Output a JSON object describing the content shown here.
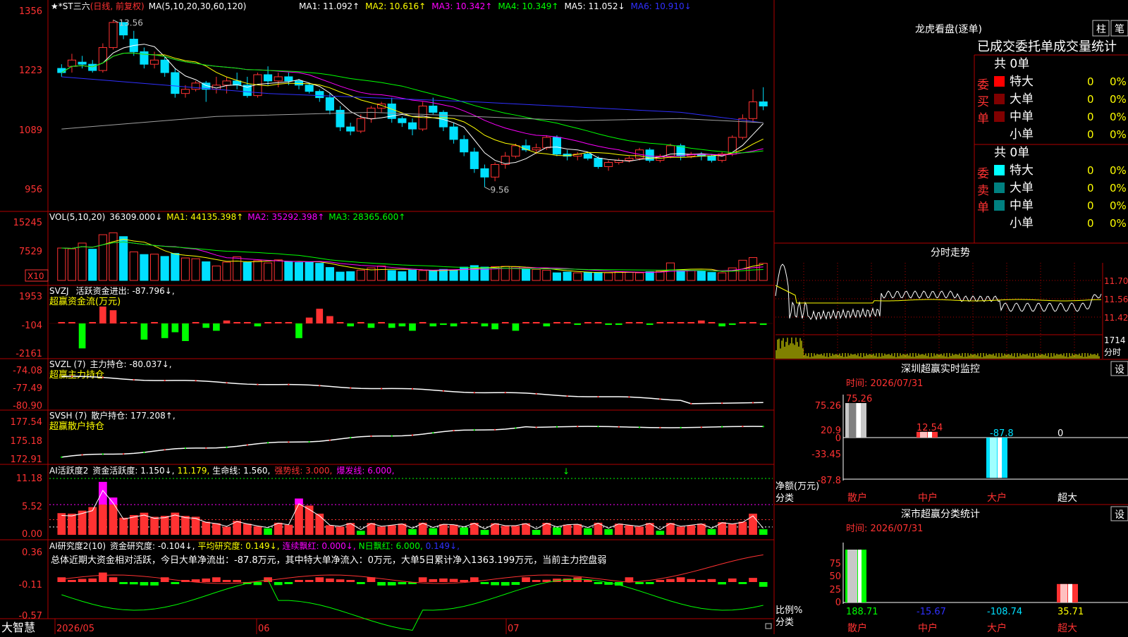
{
  "colors": {
    "up": "#ff3232",
    "down": "#00e0ff",
    "grid": "#b00000",
    "yellow": "#ffff00",
    "white": "#ffffff",
    "magenta": "#ff00ff",
    "green": "#00ff00",
    "blue": "#3030ff",
    "gray": "#a0a0a0"
  },
  "main": {
    "title_prefix": "★*ST三六",
    "title_mode": "(日线, 前复权)",
    "ma_label": "MA(5,10,20,30,60,120)",
    "ma_values": [
      {
        "text": "MA1: 11.092↑",
        "color": "#ffffff"
      },
      {
        "text": "MA2: 10.616↑",
        "color": "#ffff00"
      },
      {
        "text": "MA3: 10.342↑",
        "color": "#ff00ff"
      },
      {
        "text": "MA4: 10.349↑",
        "color": "#00ff00"
      },
      {
        "text": "MA5: 11.052↓",
        "color": "#ffffff"
      },
      {
        "text": "MA6: 10.910↓",
        "color": "#3030ff"
      }
    ],
    "y_ticks": [
      "1356",
      "1223",
      "1089",
      "956"
    ],
    "high_label": "13.56",
    "low_label": "9.56"
  },
  "vol": {
    "title": "VOL(5,10,20)",
    "value": "36309.000↓",
    "ma1": "MA1: 44135.398↑",
    "ma2": "MA2: 35292.398↑",
    "ma3": "MA3: 28365.600↑",
    "y_ticks": [
      "15245",
      "7529"
    ],
    "unit": "X10"
  },
  "svzj": {
    "title": "SVZJ",
    "label": "活跃资金进出: -87.796↓,",
    "sub": "超赢资金流(万元)",
    "y_ticks": [
      "1953",
      "-104",
      "-2161"
    ]
  },
  "svzl": {
    "title": "SVZL (7)",
    "label": "主力持仓: -80.037↓,",
    "sub": "超赢主力持仓",
    "y_ticks": [
      "-74.08",
      "-77.49",
      "-80.90"
    ]
  },
  "svsh": {
    "title": "SVSH (7)",
    "label": "散户持仓: 177.208↑,",
    "sub": "超赢散户持仓",
    "y_ticks": [
      "177.54",
      "175.18",
      "172.91"
    ]
  },
  "ai1": {
    "title": "AI活跃度2",
    "label": "资金活跃度: 1.150↓,",
    "v2": "11.179,",
    "v3": "生命线: 1.560,",
    "v4": "强势线: 3.000,",
    "v5": "爆发线: 6.000,",
    "y_ticks": [
      "11.18",
      "5.52",
      "0.00"
    ]
  },
  "ai2": {
    "title": "AI研究度2(10)",
    "label": "资金研究度: -0.104↓,",
    "v2": "平均研究度: 0.149↓,",
    "v3": "连续飘红: 0.000↓,",
    "v4": "N日飘红: 6.000,",
    "v5": "0.149↓,",
    "note": "总体近期大资金相对活跃，今日大单净流出：-87.8万元，其中特大单净流入：0万元，大单5日累计净入1363.199万元，当前主力控盘弱",
    "y_ticks": [
      "0.36",
      "-0.11",
      "-0.57"
    ]
  },
  "xaxis": {
    "brand": "大智慧",
    "labels": [
      "2026/05",
      "06",
      "07"
    ]
  },
  "right": {
    "lhb_title": "龙虎看盘(逐单)",
    "btn1": "柱",
    "btn2": "笔",
    "stat_title": "已成交委托单成交量统计",
    "buy_side": "委买单",
    "sell_side": "委卖单",
    "buy_total": "共 0单",
    "sell_total": "共 0单",
    "rows": [
      {
        "name": "特大",
        "count": "0",
        "pct": "0%"
      },
      {
        "name": "大单",
        "count": "0",
        "pct": "0%"
      },
      {
        "name": "中单",
        "count": "0",
        "pct": "0%"
      },
      {
        "name": "小单",
        "count": "0",
        "pct": "0%"
      }
    ],
    "fs_title": "分时走势",
    "fs_ticks": [
      "11.70",
      "11.56",
      "11.42"
    ],
    "fs_vol": "1714",
    "fs_unit": "分时",
    "mon_title": "深圳超赢实时监控",
    "mon_set": "设",
    "mon_time": "时间: 2026/07/31",
    "mon_ticks": [
      "75.26",
      "20.9",
      "0",
      "-33.45",
      "-87.8"
    ],
    "mon_bar_labels": [
      "75.26",
      "12.54",
      "-87.8",
      "0"
    ],
    "mon_ylabel": "净额(万元)",
    "mon_xlabel": "分类",
    "cats": [
      "散户",
      "中户",
      "大户",
      "超大"
    ],
    "cls_title": "深市超赢分类统计",
    "cls_set": "设",
    "cls_time": "时间: 2026/07/31",
    "cls_ticks": [
      "75",
      "50",
      "25",
      "0"
    ],
    "cls_values": [
      "188.71",
      "-15.67",
      "-108.74",
      "35.71"
    ],
    "cls_ylabel": "比例%",
    "cls_xlabel": "分类"
  },
  "chart_data": [
    {
      "type": "candlestick",
      "title": "★*ST三六 (日线, 前复权)",
      "ylim": [
        9.4,
        13.7
      ],
      "high": 13.56,
      "low": 9.56,
      "ohlc": [
        [
          12.4,
          12.5,
          12.2,
          12.3
        ],
        [
          12.45,
          12.75,
          12.3,
          12.6
        ],
        [
          12.55,
          12.7,
          12.4,
          12.5
        ],
        [
          12.5,
          12.6,
          12.3,
          12.35
        ],
        [
          12.35,
          13.0,
          12.3,
          12.9
        ],
        [
          12.9,
          13.56,
          12.85,
          13.5
        ],
        [
          13.5,
          13.5,
          13.1,
          13.2
        ],
        [
          13.1,
          13.3,
          12.7,
          12.8
        ],
        [
          12.8,
          12.9,
          12.4,
          12.5
        ],
        [
          12.5,
          12.8,
          12.4,
          12.6
        ],
        [
          12.6,
          12.7,
          12.2,
          12.3
        ],
        [
          12.3,
          12.4,
          11.7,
          11.8
        ],
        [
          11.8,
          12.0,
          11.7,
          11.9
        ],
        [
          11.9,
          12.1,
          11.85,
          12.05
        ],
        [
          12.05,
          12.1,
          11.6,
          11.9
        ],
        [
          11.9,
          12.2,
          11.8,
          12.0
        ],
        [
          12.0,
          12.2,
          11.8,
          12.1
        ],
        [
          12.1,
          12.3,
          11.9,
          12.0
        ],
        [
          12.0,
          12.2,
          11.7,
          11.75
        ],
        [
          11.75,
          12.3,
          11.7,
          12.25
        ],
        [
          12.25,
          12.45,
          12.0,
          12.1
        ],
        [
          12.1,
          12.3,
          11.95,
          12.2
        ],
        [
          12.2,
          12.3,
          12.0,
          12.1
        ],
        [
          12.1,
          12.15,
          11.9,
          12.0
        ],
        [
          12.0,
          12.05,
          11.8,
          11.85
        ],
        [
          11.85,
          11.9,
          11.6,
          11.7
        ],
        [
          11.7,
          11.8,
          11.3,
          11.4
        ],
        [
          11.4,
          11.5,
          10.9,
          11.0
        ],
        [
          11.0,
          11.1,
          10.8,
          10.9
        ],
        [
          10.9,
          11.3,
          10.85,
          11.2
        ],
        [
          11.2,
          11.5,
          11.1,
          11.45
        ],
        [
          11.45,
          11.6,
          11.35,
          11.55
        ],
        [
          11.55,
          11.7,
          11.1,
          11.2
        ],
        [
          11.2,
          11.25,
          11.0,
          11.1
        ],
        [
          11.1,
          11.2,
          10.8,
          10.95
        ],
        [
          10.95,
          11.6,
          10.9,
          11.5
        ],
        [
          11.5,
          11.7,
          11.3,
          11.35
        ],
        [
          11.35,
          11.4,
          10.9,
          11.0
        ],
        [
          11.0,
          11.1,
          10.6,
          10.7
        ],
        [
          10.7,
          10.8,
          10.3,
          10.4
        ],
        [
          10.4,
          10.5,
          9.9,
          10.0
        ],
        [
          10.0,
          10.1,
          9.56,
          9.8
        ],
        [
          9.8,
          10.15,
          9.7,
          10.1
        ],
        [
          10.1,
          10.4,
          10.0,
          10.3
        ],
        [
          10.3,
          10.6,
          10.25,
          10.55
        ],
        [
          10.55,
          10.7,
          10.4,
          10.45
        ],
        [
          10.45,
          10.6,
          10.35,
          10.5
        ],
        [
          10.5,
          10.8,
          10.45,
          10.75
        ],
        [
          10.75,
          10.8,
          10.3,
          10.35
        ],
        [
          10.35,
          10.45,
          10.2,
          10.3
        ],
        [
          10.3,
          10.4,
          10.2,
          10.35
        ],
        [
          10.35,
          10.4,
          10.2,
          10.25
        ],
        [
          10.25,
          10.3,
          10.0,
          10.05
        ],
        [
          10.05,
          10.2,
          9.95,
          10.15
        ],
        [
          10.15,
          10.25,
          10.1,
          10.2
        ],
        [
          10.2,
          10.3,
          10.15,
          10.25
        ],
        [
          10.25,
          10.5,
          10.2,
          10.45
        ],
        [
          10.45,
          10.5,
          10.15,
          10.2
        ],
        [
          10.2,
          10.35,
          10.15,
          10.3
        ],
        [
          10.3,
          10.6,
          10.25,
          10.55
        ],
        [
          10.55,
          10.6,
          10.2,
          10.3
        ],
        [
          10.3,
          10.4,
          10.25,
          10.35
        ],
        [
          10.35,
          10.4,
          10.2,
          10.3
        ],
        [
          10.3,
          10.35,
          10.15,
          10.2
        ],
        [
          10.2,
          10.4,
          10.15,
          10.35
        ],
        [
          10.35,
          10.8,
          10.3,
          10.75
        ],
        [
          10.75,
          11.3,
          10.7,
          11.2
        ],
        [
          11.2,
          11.9,
          11.1,
          11.6
        ],
        [
          11.6,
          11.95,
          11.4,
          11.5
        ]
      ]
    },
    {
      "type": "bar",
      "title": "VOL(5,10,20)",
      "ylim": [
        0,
        17000
      ],
      "values": [
        8500,
        8300,
        9800,
        8200,
        12000,
        12500,
        11500,
        7500,
        6800,
        6900,
        6300,
        7100,
        5900,
        5700,
        4900,
        3800,
        4800,
        6200,
        4700,
        5200,
        4600,
        5400,
        5000,
        4700,
        4800,
        4500,
        3400,
        2200,
        2300,
        2700,
        3300,
        3800,
        2600,
        2300,
        2700,
        2600,
        2600,
        2900,
        2700,
        3500,
        3900,
        3500,
        3600,
        3700,
        3600,
        3000,
        2900,
        2700,
        2000,
        2200,
        2000,
        2100,
        2100,
        2000,
        2300,
        2200,
        2000,
        2300,
        2500,
        4600,
        2800,
        2600,
        2400,
        2100,
        2000,
        3300,
        5300,
        6000,
        4500
      ],
      "up": [
        true,
        true,
        true,
        false,
        true,
        true,
        false,
        true,
        false,
        true,
        false,
        false,
        true,
        true,
        false,
        true,
        true,
        true,
        false,
        true,
        true,
        true,
        false,
        false,
        false,
        false,
        false,
        false,
        false,
        true,
        true,
        true,
        false,
        false,
        false,
        true,
        false,
        false,
        false,
        false,
        false,
        false,
        true,
        true,
        true,
        false,
        true,
        true,
        false,
        false,
        true,
        false,
        false,
        true,
        true,
        true,
        true,
        false,
        true,
        true,
        false,
        true,
        false,
        false,
        true,
        true,
        true,
        true,
        true
      ]
    },
    {
      "type": "bar",
      "title": "SVZJ 活跃资金进出",
      "ylim": [
        -2161,
        1953
      ],
      "values": [
        0,
        0,
        -1700,
        0,
        1150,
        900,
        0,
        0,
        -1100,
        0,
        -1000,
        -600,
        -1200,
        0,
        -300,
        -500,
        200,
        0,
        0,
        -200,
        0,
        0,
        0,
        -1000,
        400,
        1000,
        500,
        0,
        -200,
        0,
        -300,
        0,
        -300,
        -200,
        -500,
        0,
        -200,
        -100,
        -200,
        0,
        0,
        -200,
        -400,
        0,
        -500,
        0,
        0,
        -200,
        0,
        0,
        -100,
        0,
        0,
        -100,
        -100,
        0,
        0,
        -100,
        0,
        0,
        0,
        0,
        200,
        0,
        -200,
        -100,
        0,
        0,
        -100,
        300,
        0,
        800,
        -87.8
      ]
    },
    {
      "type": "line",
      "title": "SVZL 主力持仓",
      "ylim": [
        -80.9,
        -74.08
      ]
    },
    {
      "type": "line",
      "title": "SVSH 散户持仓",
      "ylim": [
        172.91,
        177.54
      ]
    },
    {
      "type": "bar",
      "title": "AI活跃度2",
      "ylim": [
        0,
        11.18
      ],
      "lines": {
        "生命线": 1.56,
        "强势线": 3.0,
        "爆发线": 6.0
      }
    },
    {
      "type": "bar",
      "title": "AI研究度2(10)",
      "ylim": [
        -0.57,
        0.36
      ]
    },
    {
      "type": "bar",
      "title": "深圳超赢实时监控",
      "categories": [
        "散户",
        "中户",
        "大户",
        "超大"
      ],
      "values": [
        75.26,
        12.54,
        -87.8,
        0
      ],
      "ylim": [
        -87.8,
        75.26
      ]
    },
    {
      "type": "bar",
      "title": "深市超赢分类统计",
      "categories": [
        "散户",
        "中户",
        "大户",
        "超大"
      ],
      "values": [
        188.71,
        -15.67,
        -108.74,
        35.71
      ],
      "ylim": [
        0,
        75
      ]
    }
  ]
}
